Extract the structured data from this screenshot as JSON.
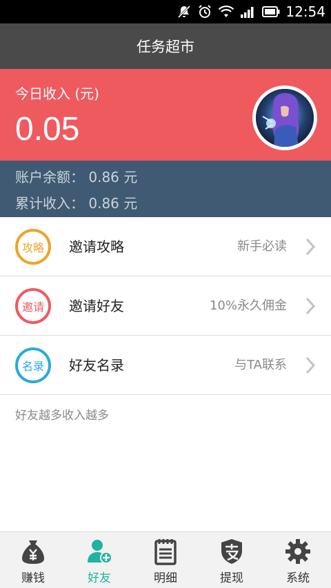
{
  "status_bar": {
    "time": "12:54"
  },
  "header": {
    "title": "任务超市"
  },
  "income": {
    "label": "今日收入 (元)",
    "value": "0.05"
  },
  "account": {
    "balance_text": "账户余额： 0.86 元",
    "total_text": "累计收入： 0.86 元"
  },
  "menu": [
    {
      "icon_text": "攻略",
      "label": "邀请攻略",
      "hint": "新手必读",
      "color": "#f0a329"
    },
    {
      "icon_text": "邀请",
      "label": "邀请好友",
      "hint": "10%永久佣金",
      "color": "#ef5a5f"
    },
    {
      "icon_text": "名录",
      "label": "好友名录",
      "hint": "与TA联系",
      "color": "#29a9e0"
    }
  ],
  "footer_tip": "好友越多收入越多",
  "tabs": [
    {
      "label": "赚钱",
      "icon": "money-bag-icon"
    },
    {
      "label": "好友",
      "icon": "add-friend-icon",
      "active": true
    },
    {
      "label": "明细",
      "icon": "notepad-icon"
    },
    {
      "label": "提现",
      "icon": "alipay-shield-icon"
    },
    {
      "label": "系统",
      "icon": "gear-icon"
    }
  ],
  "colors": {
    "accent": "#1fb3a0",
    "income_bg": "#ef5a5f",
    "balance_bg": "#3f5a72",
    "header_bg": "#4a4a4a"
  }
}
